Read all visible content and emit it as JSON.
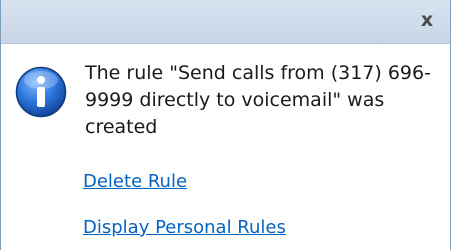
{
  "dialog": {
    "close_label": "x",
    "message": "The rule \"Send calls from (317) 696-9999 directly to voicemail\" was created",
    "icon": "info-icon",
    "links": {
      "delete_rule": "Delete Rule",
      "display_personal_rules": "Display Personal Rules"
    }
  },
  "colors": {
    "titlebar": "#cfdbea",
    "link": "#0563c1",
    "icon_blue": "#1f6fd6"
  }
}
